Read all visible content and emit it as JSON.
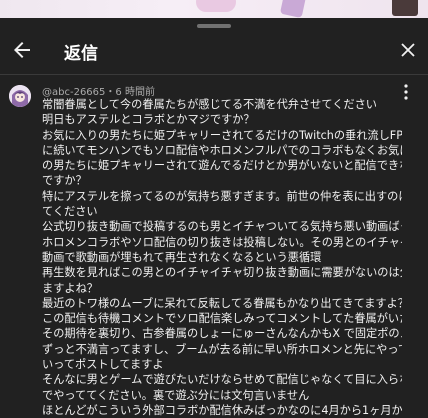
{
  "header": {
    "title": "返信"
  },
  "comment": {
    "author": "@abc-26665",
    "separator": "・",
    "time": "6 時間前",
    "lines": [
      "常闇眷属として今の眷属たちが感じてる不満を代弁させてください",
      "明日もアステルとコラボとかマジですか？",
      "お気に入りの男たちに姫プキャリーされてるだけのTwitchの垂れ流しFPS地獄",
      "に続いてモンハンでもソロ配信やホロメンフルパでのコラボもなくお気に入り",
      "の男たちに姫プキャリーされて遊んでるだけとか男がいないと配信できないん",
      "ですか？",
      "特にアステルを擦ってるのが気持ち悪すぎます。前世の仲を表に出すのはやめ",
      "てください",
      "公式切り抜き動画で投稿するのも男とイチャついてる気持ち悪い動画ばっかで",
      "ホロメンコラボやソロ配信の切り抜きは投稿しない。その男とのイチャイチャ",
      "動画で歌動画が埋もれて再生されなくなるという悪循環",
      "再生数を見ればこの男とのイチャイチャ切り抜き動画に需要がないのは分かり",
      "ますよね？",
      "最近のトワ様のムーブに呆れて反転してる眷属もかなり出てきてますよ？",
      "この配信も待機コメントでソロ配信楽しみってコメントしてた眷属がいたのに",
      "その期待を裏切り、古参眷属のしょーにゅーさんなんかもX で固定ポのメンツに",
      "ずっと不満言ってますし、ブームが去る前に早い所ホロメンと先にやってほし",
      "いってポストしてますよ",
      "そんなに男とゲームで遊びたいだけならせめて配信じゃなくて目に入らない裏",
      "でやっててください。裏で遊ぶ分には文句言いません",
      "ほとんどがこういう外部コラボか配信休みばっかなのに4月から1ヶ月か2ヶ月"
    ]
  },
  "icons": {
    "back": "back-arrow-icon",
    "close": "close-icon",
    "menu": "more-vert-icon",
    "avatar": "user-avatar"
  },
  "colors": {
    "background": "#212121",
    "text": "#f1f1f1",
    "meta": "#aaaaaa",
    "divider": "#3a3a3a"
  }
}
